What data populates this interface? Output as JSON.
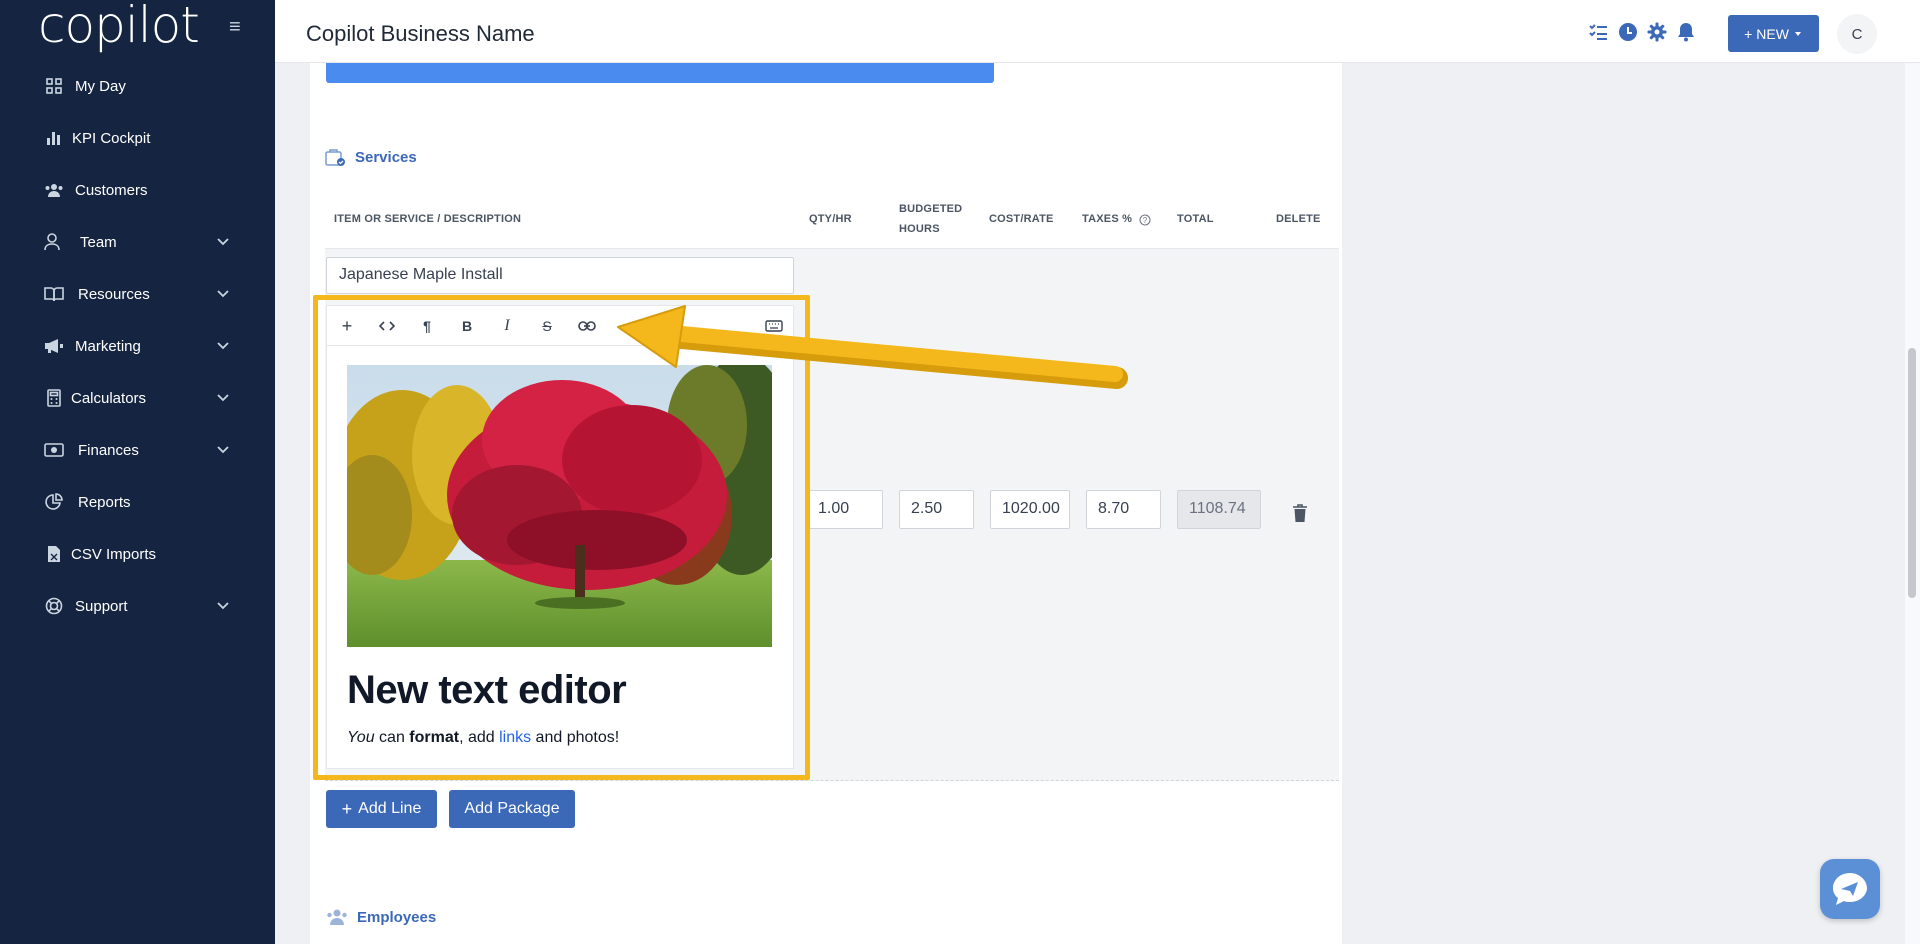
{
  "app": {
    "logo": "copilot",
    "title": "Copilot Business Name"
  },
  "sidebar": {
    "items": [
      {
        "label": "My Day",
        "icon": "grid-icon",
        "chevron": false
      },
      {
        "label": "KPI Cockpit",
        "icon": "bar-chart-icon",
        "chevron": false
      },
      {
        "label": "Customers",
        "icon": "users-icon",
        "chevron": false
      },
      {
        "label": "Team",
        "icon": "user-icon",
        "chevron": true
      },
      {
        "label": "Resources",
        "icon": "book-icon",
        "chevron": true
      },
      {
        "label": "Marketing",
        "icon": "megaphone-icon",
        "chevron": true
      },
      {
        "label": "Calculators",
        "icon": "calculator-icon",
        "chevron": true
      },
      {
        "label": "Finances",
        "icon": "money-icon",
        "chevron": true
      },
      {
        "label": "Reports",
        "icon": "pie-chart-icon",
        "chevron": false
      },
      {
        "label": "CSV Imports",
        "icon": "file-icon",
        "chevron": false
      },
      {
        "label": "Support",
        "icon": "lifebuoy-icon",
        "chevron": true
      }
    ]
  },
  "topbar": {
    "new_label": "NEW",
    "avatar_initial": "C"
  },
  "services": {
    "title": "Services",
    "headers": {
      "item": "ITEM OR SERVICE / DESCRIPTION",
      "qty": "QTY/HR",
      "budgeted_1": "BUDGETED",
      "budgeted_2": "HOURS",
      "cost": "COST/RATE",
      "taxes": "TAXES %",
      "total": "TOTAL",
      "delete": "DELETE"
    },
    "row": {
      "item": "Japanese Maple Install",
      "qty": "1.00",
      "hours": "2.50",
      "cost": "1020.00",
      "taxes": "8.70",
      "total": "1108.74"
    },
    "editor": {
      "heading": "New text editor",
      "text_italic": "You",
      "text_1": " can ",
      "text_bold": "format",
      "text_2": ", add ",
      "text_link": "links",
      "text_3": " and photos!"
    },
    "add_line_label": "Add Line",
    "add_package_label": "Add Package"
  },
  "employees": {
    "title": "Employees"
  },
  "colors": {
    "sidebar": "#152440",
    "accent": "#3c69b7",
    "highlight": "#f5b81c",
    "progress": "#4a8bf0"
  }
}
